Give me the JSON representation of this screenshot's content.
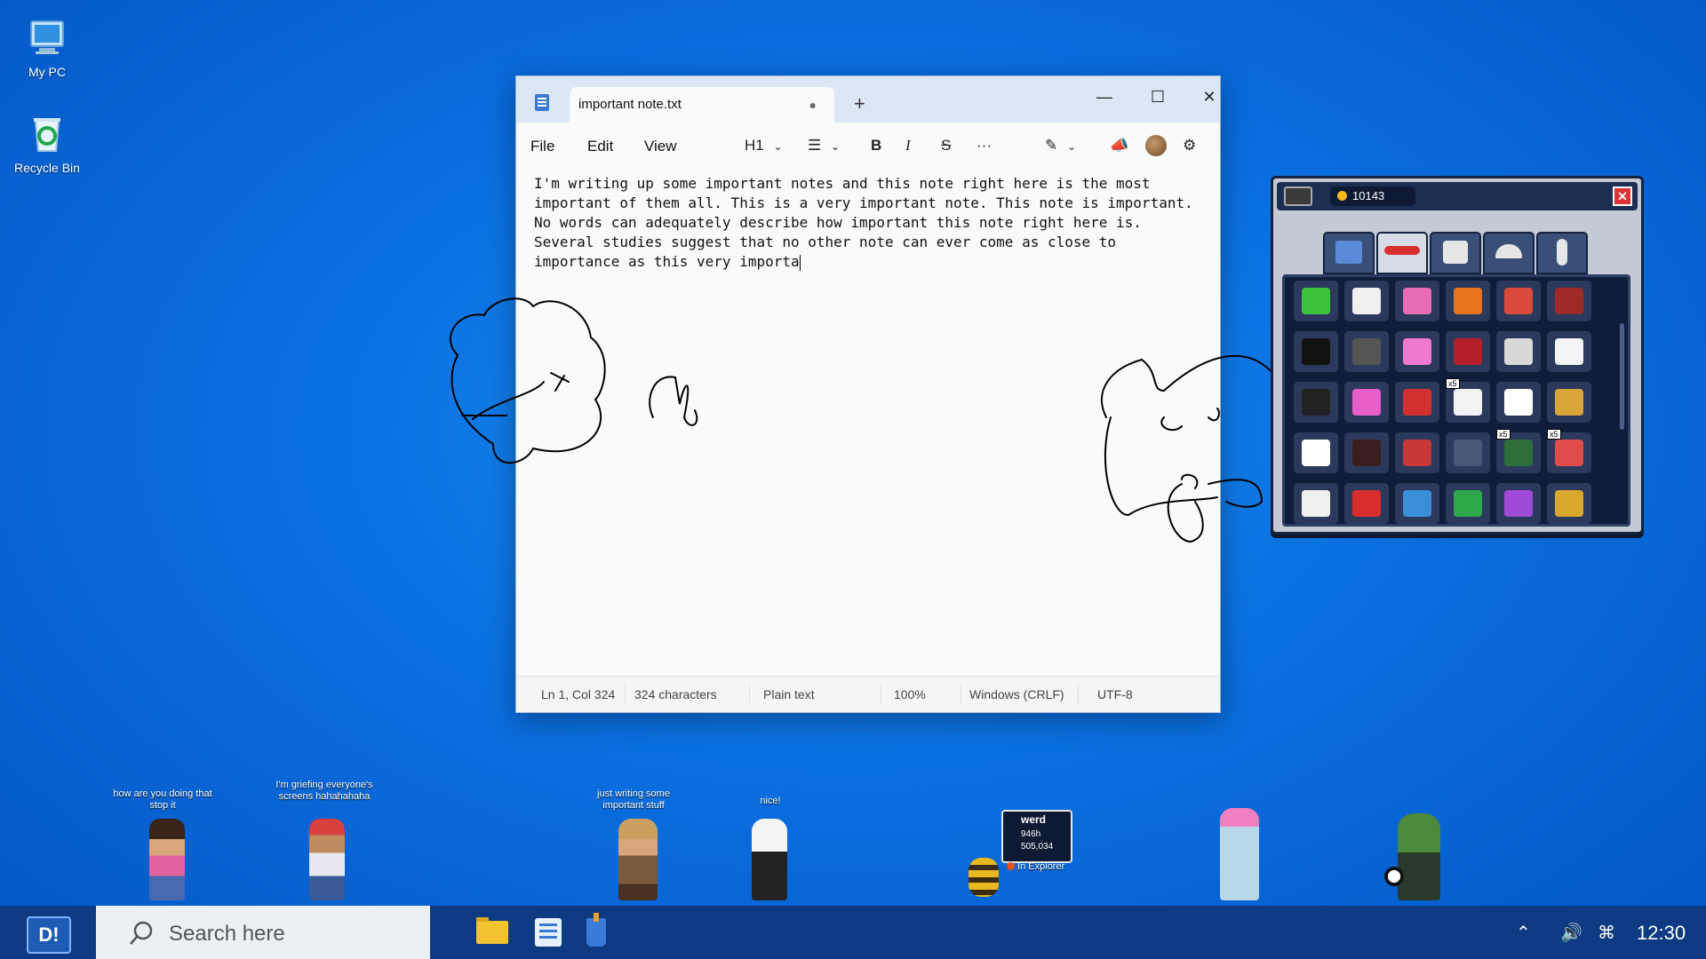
{
  "desktop": {
    "icons": [
      {
        "label": "My PC",
        "icon": "computer-icon"
      },
      {
        "label": "Recycle Bin",
        "icon": "recycle-bin-icon"
      }
    ]
  },
  "notepad": {
    "tab_title": "important note.txt",
    "unsaved_dot": "●",
    "new_tab": "+",
    "menu": {
      "file": "File",
      "edit": "Edit",
      "view": "View"
    },
    "toolbar": {
      "heading": "H1",
      "bold": "B",
      "italic": "I",
      "strike": "S",
      "more": "···"
    },
    "text": "I'm writing up some important notes and this note right here is the most\nimportant of them all. This is a very important note. This note is important.\nNo words can adequately describe how important this note right here is.\nSeveral studies suggest that no other note can ever come as close to\nimportance as this very importa",
    "status": {
      "position": "Ln 1, Col 324",
      "characters": "324 characters",
      "format": "Plain text",
      "zoom": "100%",
      "line_endings": "Windows (CRLF)",
      "encoding": "UTF-8"
    }
  },
  "inventory": {
    "coins": "10143",
    "badge": "x5",
    "tabs": [
      "crate-icon",
      "airplane-icon",
      "shirt-icon",
      "cap-icon",
      "avatar-icon"
    ],
    "items": [
      {
        "icon": "plus-icon",
        "color": "#3cc23c"
      },
      {
        "icon": "glove-icon",
        "color": "#f0f0f0"
      },
      {
        "icon": "potion-icon",
        "color": "#e86bb4"
      },
      {
        "icon": "basketball-icon",
        "color": "#e8731e"
      },
      {
        "icon": "paint-roller-icon",
        "color": "#d94a3a"
      },
      {
        "icon": "plane-icon",
        "color": "#9e2a2a"
      },
      {
        "icon": "eight-ball-icon",
        "color": "#111111"
      },
      {
        "icon": "boombox-icon",
        "color": "#555555"
      },
      {
        "icon": "pink-box-icon",
        "color": "#f07ad0"
      },
      {
        "icon": "red-box-icon",
        "color": "#b3202a"
      },
      {
        "icon": "white-box-icon",
        "color": "#d8d8d8"
      },
      {
        "icon": "white-car-icon",
        "color": "#f4f4f4"
      },
      {
        "icon": "black-car-icon",
        "color": "#222222"
      },
      {
        "icon": "pink-car-icon",
        "color": "#e85ec8"
      },
      {
        "icon": "red-car-icon",
        "color": "#d23030"
      },
      {
        "icon": "cigarette-icon",
        "color": "#f2f2f2"
      },
      {
        "icon": "clap-icon",
        "color": "#ffffff"
      },
      {
        "icon": "gold-coin-icon",
        "color": "#d8a53a"
      },
      {
        "icon": "dice-icon",
        "color": "#ffffff"
      },
      {
        "icon": "clock-icon",
        "color": "#3a1e1e"
      },
      {
        "icon": "drum-icon",
        "color": "#c83838"
      },
      {
        "icon": "dumbbell-icon",
        "color": "#4a5878"
      },
      {
        "icon": "splat-icon",
        "color": "#2e6e3a"
      },
      {
        "icon": "firework-icon",
        "color": "#e04c4c"
      },
      {
        "icon": "tooth-icon",
        "color": "#f0f0f0"
      },
      {
        "icon": "lips-icon",
        "color": "#d82d2d"
      },
      {
        "icon": "blue-plane-icon",
        "color": "#3a8ed8"
      },
      {
        "icon": "green-plane-icon",
        "color": "#2ea84a"
      },
      {
        "icon": "purple-plane-icon",
        "color": "#a04ad8"
      },
      {
        "icon": "gold-plane-icon",
        "color": "#d8a82e"
      }
    ]
  },
  "avatars": [
    {
      "bubble": "how are you doing that stop it"
    },
    {
      "bubble": "I'm griefing everyone's screens hahahahaha"
    },
    {
      "bubble": "just writing some important stuff"
    },
    {
      "bubble": "nice!"
    }
  ],
  "player_card": {
    "name": "werd",
    "hours": "946h",
    "coins": "505,034",
    "status": "In Explorer"
  },
  "taskbar": {
    "start_label": "D!",
    "search_placeholder": "Search here",
    "time": "12:30"
  }
}
